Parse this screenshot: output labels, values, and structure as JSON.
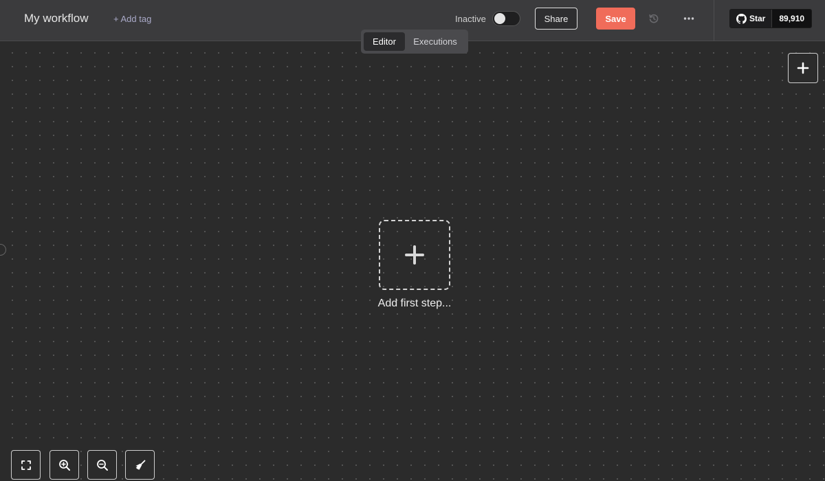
{
  "header": {
    "workflow_name": "My workflow",
    "add_tag_label": "+ Add tag",
    "status_label": "Inactive",
    "share_label": "Share",
    "save_label": "Save",
    "history_icon": "history-icon",
    "more_icon": "more-horizontal-icon",
    "github": {
      "icon": "github-icon",
      "star_label": "Star",
      "star_count": "89,910"
    }
  },
  "tabs": [
    {
      "label": "Editor",
      "active": true
    },
    {
      "label": "Executions",
      "active": false
    }
  ],
  "canvas": {
    "add_node_icon": "plus-icon",
    "first_step_label": "Add first step..."
  },
  "controls": [
    {
      "name": "zoom-to-fit-button",
      "icon": "fit-view-icon"
    },
    {
      "name": "zoom-in-button",
      "icon": "zoom-in-icon"
    },
    {
      "name": "zoom-out-button",
      "icon": "zoom-out-icon"
    },
    {
      "name": "tidy-up-button",
      "icon": "broom-icon"
    }
  ],
  "colors": {
    "save": "#f06c5a",
    "header": "#3b3b3d",
    "canvas": "#2b2b2b"
  }
}
